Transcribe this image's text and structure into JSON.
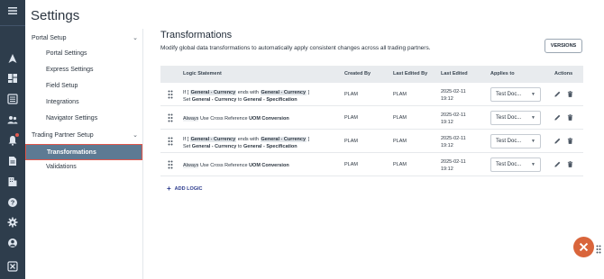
{
  "app": {
    "title": "Settings"
  },
  "rail": {
    "icons": [
      "menu-icon",
      "navigation-icon",
      "dashboard-icon",
      "list-icon",
      "users-icon",
      "bell-icon",
      "document-icon",
      "building-icon",
      "help-icon",
      "gear-icon",
      "account-icon",
      "app-icon"
    ]
  },
  "subnav": {
    "portal_setup": "Portal Setup",
    "portal_items": [
      "Portal Settings",
      "Express Settings",
      "Field Setup",
      "Integrations",
      "Navigator Settings"
    ],
    "trading_partner_setup": "Trading Partner Setup",
    "trading_items": [
      "Transformations",
      "Validations"
    ]
  },
  "main": {
    "title": "Transformations",
    "description": "Modify global data transformations to automatically apply consistent changes across all trading partners.",
    "versions_label": "VERSIONS",
    "columns": [
      "Logic Statement",
      "Created By",
      "Last Edited By",
      "Last Edited",
      "Applies to",
      "Actions"
    ],
    "rows": [
      {
        "line1": {
          "prefix": "If [",
          "field": "General - Currency",
          "mid": "ends with",
          "field2": "General - Currency",
          "suffix": "]"
        },
        "line2": {
          "prefix": "Set",
          "field": "General - Currency",
          "mid": "to",
          "field2": "General - Specification"
        },
        "created_by": "PLAM",
        "edited_by": "PLAM",
        "date": "2025-02-11",
        "time": "19:12",
        "applies_to": "Test Doc..."
      },
      {
        "single": {
          "prefix": "Always",
          "mid": "Use Cross Reference",
          "field": "UOM Conversion"
        },
        "created_by": "PLAM",
        "edited_by": "PLAM",
        "date": "2025-02-11",
        "time": "19:12",
        "applies_to": "Test Doc..."
      },
      {
        "line1": {
          "prefix": "If [",
          "field": "General - Currency",
          "mid": "ends with",
          "field2": "General - Currency",
          "suffix": "]"
        },
        "line2": {
          "prefix": "Set",
          "field": "General - Currency",
          "mid": "to",
          "field2": "General - Specification"
        },
        "created_by": "PLAM",
        "edited_by": "PLAM",
        "date": "2025-02-11",
        "time": "19:12",
        "applies_to": "Test Doc..."
      },
      {
        "single": {
          "prefix": "Always",
          "mid": "Use Cross Reference",
          "field": "UOM Conversion"
        },
        "created_by": "PLAM",
        "edited_by": "PLAM",
        "date": "2025-02-11",
        "time": "19:12",
        "applies_to": "Test Doc..."
      }
    ],
    "add_logic_label": "ADD LOGIC"
  },
  "colors": {
    "rail": "#2e3d4c",
    "active": "#5d7a93",
    "highlight_border": "#e0554a",
    "fab": "#d9653b",
    "link": "#2b3a8c"
  }
}
